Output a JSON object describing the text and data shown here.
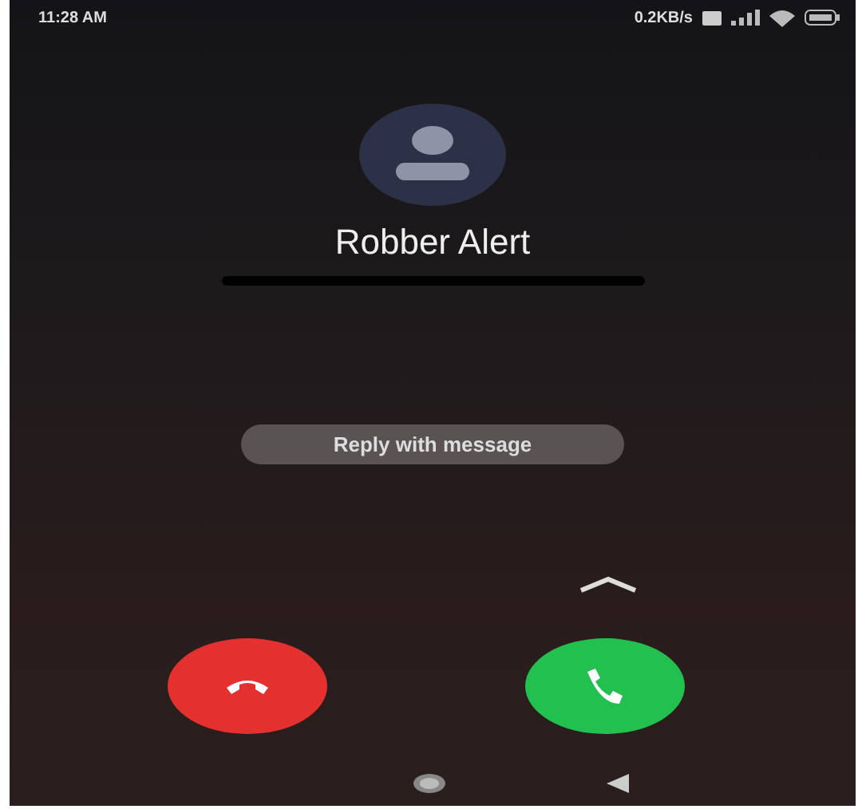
{
  "status_bar": {
    "time": "11:28 AM",
    "speed": "0.2KB/s"
  },
  "caller": {
    "name": "Robber Alert",
    "number_hidden": true
  },
  "reply_button": {
    "label": "Reply with message"
  },
  "call_buttons": [
    {
      "kind": "decline"
    },
    {
      "kind": "answer"
    }
  ]
}
